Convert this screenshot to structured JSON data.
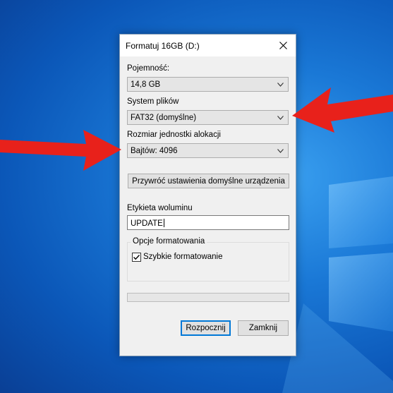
{
  "dialog": {
    "title": "Formatuj 16GB (D:)",
    "capacity": {
      "label": "Pojemność:",
      "value": "14,8 GB"
    },
    "file_system": {
      "label": "System plików",
      "value": "FAT32 (domyślne)"
    },
    "allocation_unit": {
      "label": "Rozmiar jednostki alokacji",
      "value": "Bajtów: 4096"
    },
    "restore_defaults_label": "Przywróć ustawienia domyślne urządzenia",
    "volume_label": {
      "label": "Etykieta woluminu",
      "value": "UPDATE"
    },
    "format_options": {
      "title": "Opcje formatowania",
      "quick_format_label": "Szybkie formatowanie",
      "quick_format_checked": true
    },
    "progress": 0,
    "start_label": "Rozpocznij",
    "close_label": "Zamknij"
  },
  "colors": {
    "annotation_arrow": "#e8211b",
    "default_button_border": "#0078d7",
    "desktop_background": "#1a78d6"
  }
}
